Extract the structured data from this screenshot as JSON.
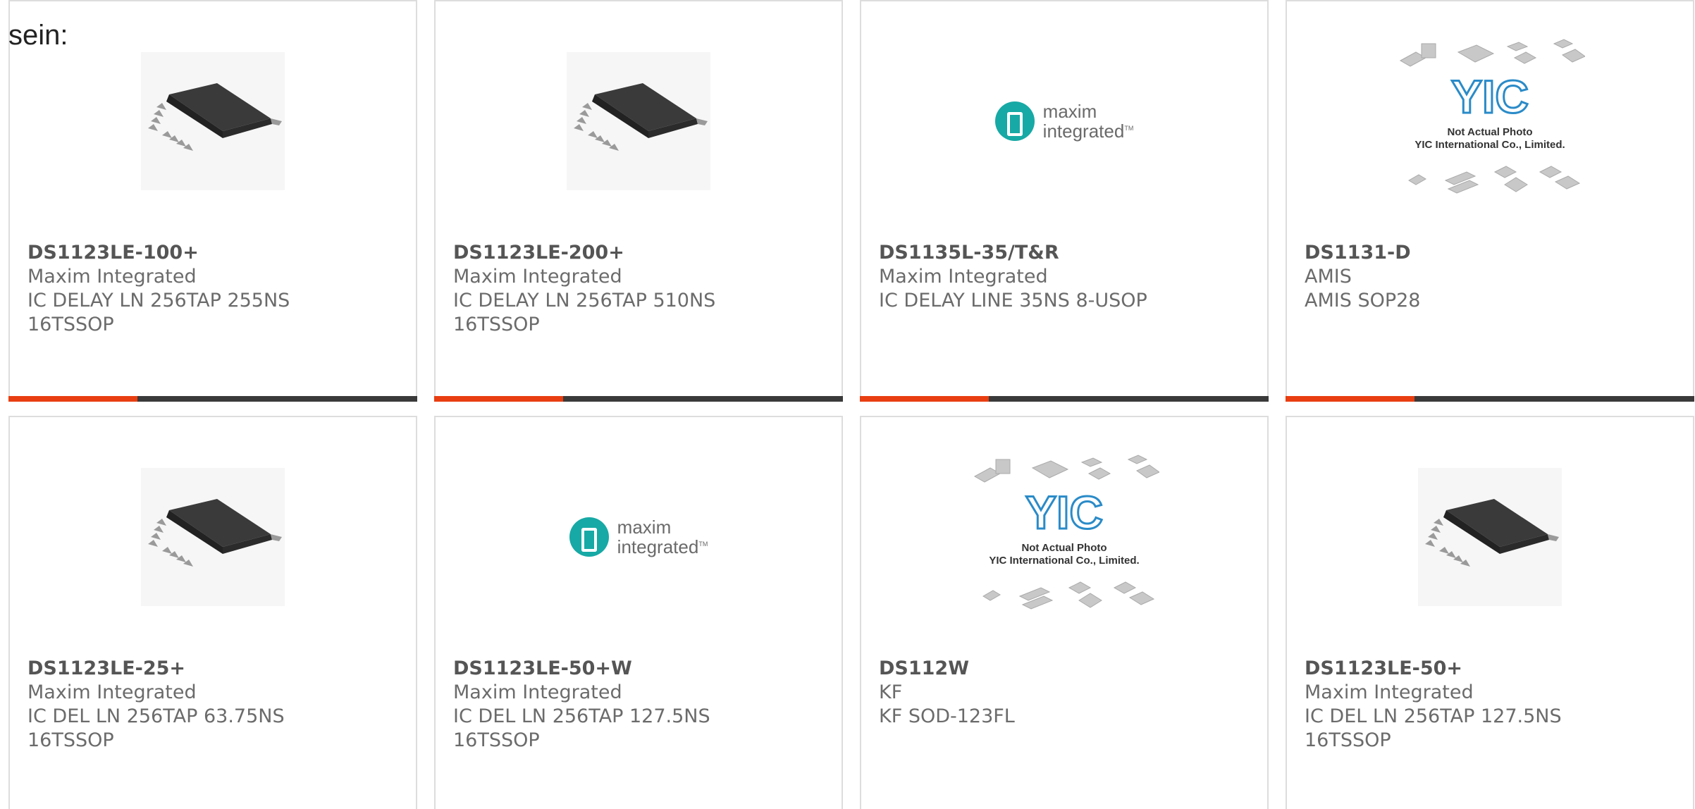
{
  "intro_text": "sein:",
  "colors": {
    "accent": "#e83e11",
    "bar": "#3a3a3a",
    "maxim_teal": "#17a9a5",
    "border": "#dddddd"
  },
  "cards": [
    {
      "part": "DS1123LE-100+",
      "brand": "Maxim Integrated",
      "desc": "IC DELAY LN 256TAP 255NS",
      "pkg": "16TSSOP",
      "image": "tssop-chip-photo"
    },
    {
      "part": "DS1123LE-200+",
      "brand": "Maxim Integrated",
      "desc": "IC DELAY LN 256TAP 510NS",
      "pkg": "16TSSOP",
      "image": "tssop-chip-photo"
    },
    {
      "part": "DS1135L-35/T&R",
      "brand": "Maxim Integrated",
      "desc": "IC DELAY LINE 35NS 8-USOP",
      "pkg": "",
      "image": "maxim-integrated-logo"
    },
    {
      "part": "DS1131-D",
      "brand": "AMIS",
      "desc": "AMIS SOP28",
      "pkg": "",
      "image": "yic-placeholder"
    },
    {
      "part": "DS1123LE-25+",
      "brand": "Maxim Integrated",
      "desc": "IC DEL LN 256TAP 63.75NS",
      "pkg": "16TSSOP",
      "image": "tssop-chip-photo"
    },
    {
      "part": "DS1123LE-50+W",
      "brand": "Maxim Integrated",
      "desc": "IC DEL LN 256TAP 127.5NS",
      "pkg": "16TSSOP",
      "image": "maxim-integrated-logo"
    },
    {
      "part": "DS112W",
      "brand": "KF",
      "desc": "KF SOD-123FL",
      "pkg": "",
      "image": "yic-placeholder"
    },
    {
      "part": "DS1123LE-50+",
      "brand": "Maxim Integrated",
      "desc": "IC DEL LN 256TAP 127.5NS",
      "pkg": "16TSSOP",
      "image": "tssop-chip-photo"
    }
  ],
  "maxim_logo": {
    "line1": "maxim",
    "line2": "integrated",
    "tm": "TM"
  },
  "yic_placeholder": {
    "mark": "YIC",
    "line1": "Not Actual Photo",
    "line2": "YIC International Co., Limited."
  }
}
